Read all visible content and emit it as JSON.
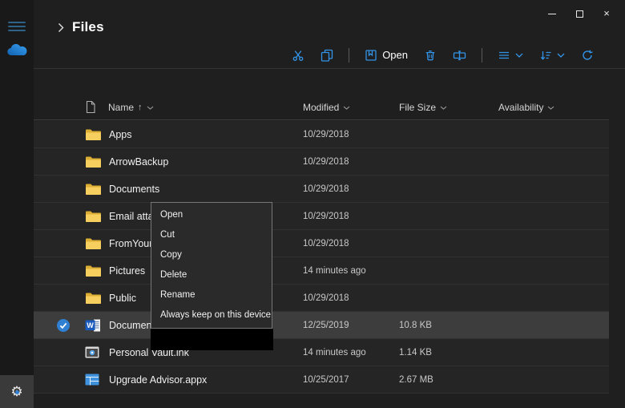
{
  "app": {
    "title": "Files"
  },
  "window_controls": {
    "close_glyph": "×"
  },
  "toolbar": {
    "open_label": "Open"
  },
  "columns": {
    "name": "Name",
    "name_sort_arrow": "↑",
    "modified": "Modified",
    "file_size": "File Size",
    "availability": "Availability"
  },
  "table": {
    "rows": [
      {
        "name": "Apps",
        "icon": "folder",
        "modified": "10/29/2018",
        "file_size": "",
        "availability": "",
        "selected": false
      },
      {
        "name": "ArrowBackup",
        "icon": "folder",
        "modified": "10/29/2018",
        "file_size": "",
        "availability": "",
        "selected": false
      },
      {
        "name": "Documents",
        "icon": "folder",
        "modified": "10/29/2018",
        "file_size": "",
        "availability": "",
        "selected": false
      },
      {
        "name": "Email atta",
        "icon": "folder",
        "modified": "10/29/2018",
        "file_size": "",
        "availability": "",
        "selected": false
      },
      {
        "name": "FromYour",
        "icon": "folder",
        "modified": "10/29/2018",
        "file_size": "",
        "availability": "",
        "selected": false
      },
      {
        "name": "Pictures",
        "icon": "folder",
        "modified": "14 minutes ago",
        "file_size": "",
        "availability": "",
        "selected": false
      },
      {
        "name": "Public",
        "icon": "folder",
        "modified": "10/29/2018",
        "file_size": "",
        "availability": "",
        "selected": false
      },
      {
        "name": "Documen",
        "icon": "word",
        "modified": "12/25/2019",
        "file_size": "10.8 KB",
        "availability": "",
        "selected": true
      },
      {
        "name": "Personal Vault.lnk",
        "icon": "vault",
        "modified": "14 minutes ago",
        "file_size": "1.14 KB",
        "availability": "",
        "selected": false
      },
      {
        "name": "Upgrade Advisor.appx",
        "icon": "appx",
        "modified": "10/25/2017",
        "file_size": "2.67 MB",
        "availability": "",
        "selected": false
      }
    ]
  },
  "context_menu": {
    "items": [
      "Open",
      "Cut",
      "Copy",
      "Delete",
      "Rename",
      "Always keep on this device"
    ]
  },
  "colors": {
    "accent": "#3294e8",
    "folder_front": "#f7cf5f",
    "folder_back": "#dcae34",
    "selected_row": "#3d3d3d",
    "check_blue": "#2f80d2",
    "word_blue": "#185abd"
  }
}
